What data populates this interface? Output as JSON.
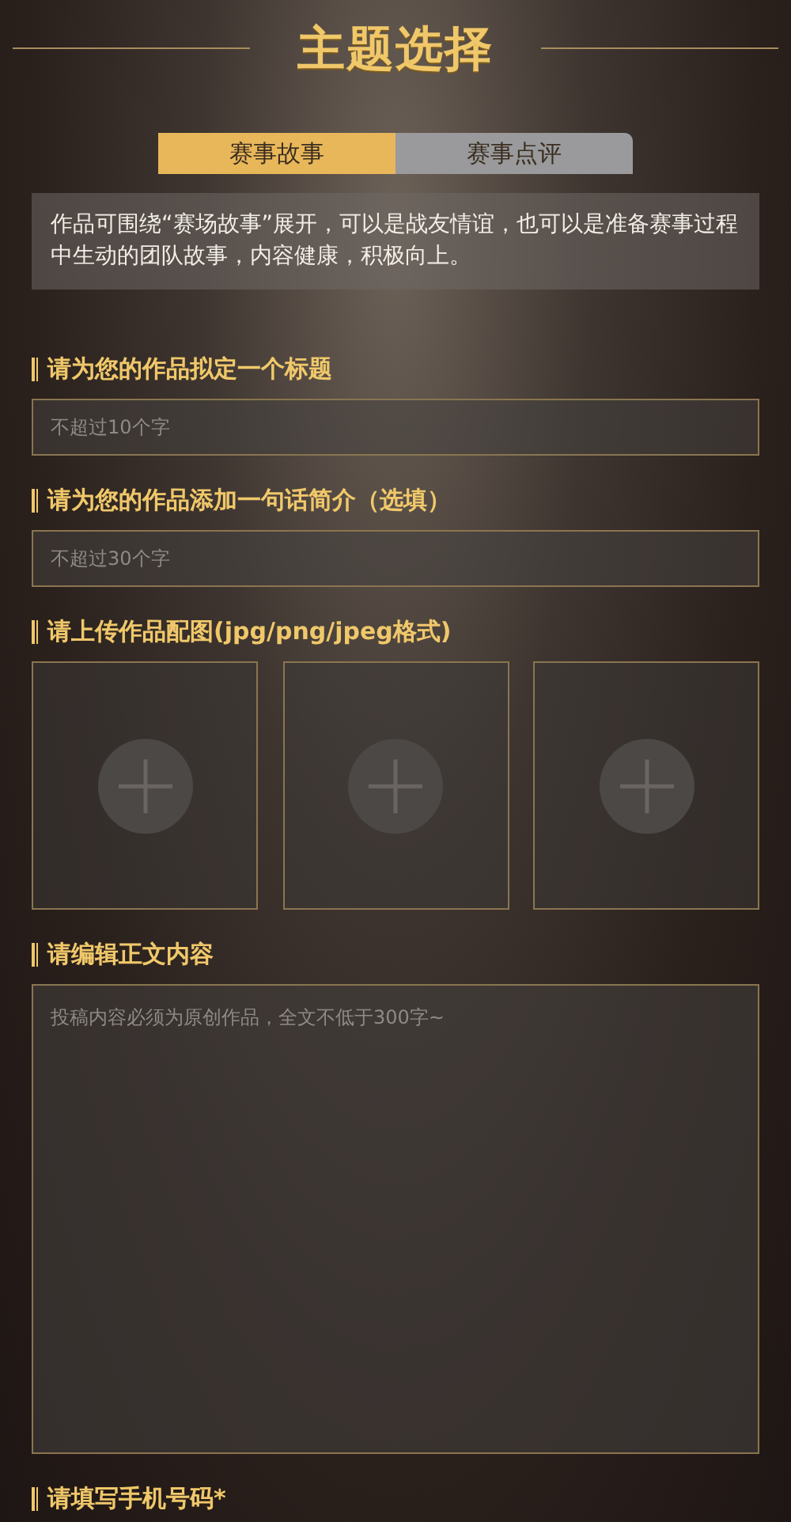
{
  "header": {
    "title": "主题选择"
  },
  "tabs": [
    {
      "label": "赛事故事",
      "selected": true
    },
    {
      "label": "赛事点评",
      "selected": false
    }
  ],
  "description": "作品可围绕“赛场故事”展开，可以是战友情谊，也可以是准备赛事过程中生动的团队故事，内容健康，积极向上。",
  "sections": [
    {
      "kind": "input",
      "label": "请为您的作品拟定一个标题",
      "placeholder": "不超过10个字"
    },
    {
      "kind": "input",
      "label": "请为您的作品添加一句话简介（选填）",
      "placeholder": "不超过30个字"
    },
    {
      "kind": "upload",
      "label": "请上传作品配图(jpg/png/jpeg格式)",
      "tiles": [
        {
          "kind": "add"
        },
        {
          "kind": "add"
        },
        {
          "kind": "add"
        }
      ]
    },
    {
      "kind": "textarea",
      "label": "请编辑正文内容",
      "placeholder": "投稿内容必须为原创作品，全文不低于300字~"
    },
    {
      "kind": "heading",
      "label": "请填写手机号码*"
    }
  ]
}
